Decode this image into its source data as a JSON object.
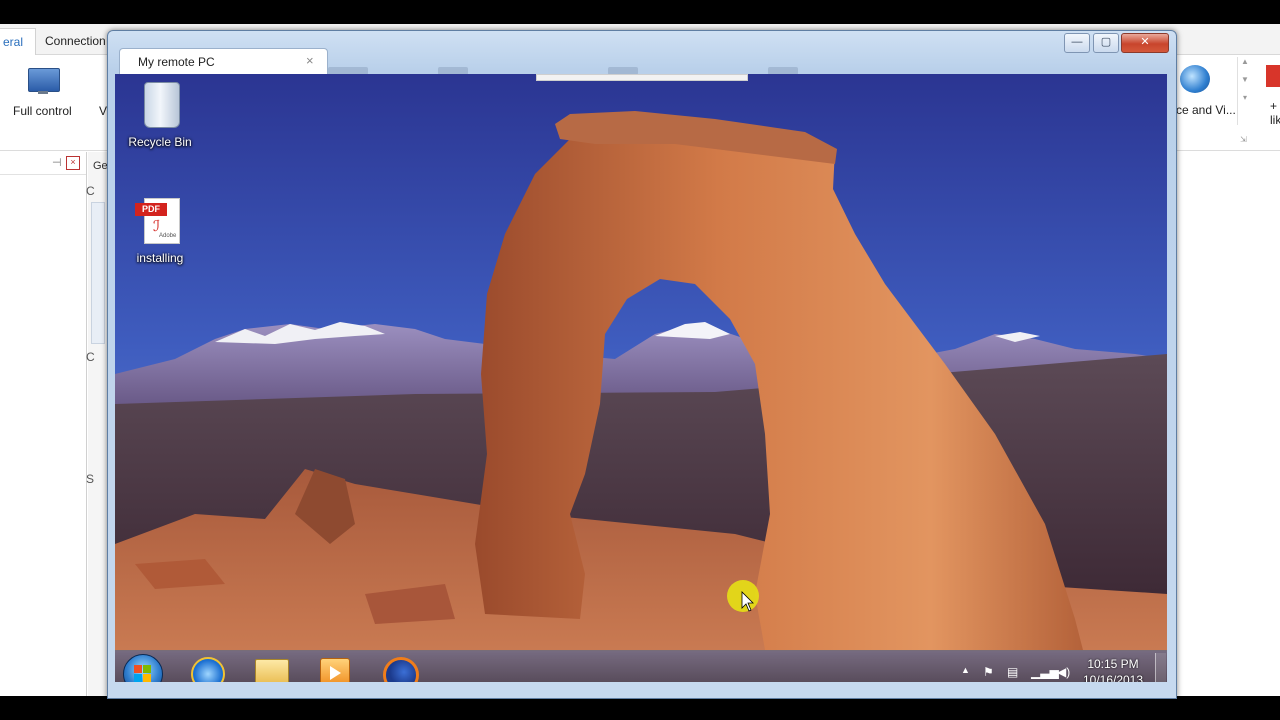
{
  "host_app": {
    "tabs": [
      {
        "label": "eral"
      },
      {
        "label": "Connection"
      }
    ],
    "ribbon": {
      "full_control_label": "Full control",
      "truncated_v_label": "V",
      "right_label": "ce and Vi...",
      "far_right_label": "+ lik"
    },
    "panel": {
      "truncated_ge": "Ge",
      "truncated_c1": "C",
      "truncated_c2": "C",
      "truncated_s": "S"
    }
  },
  "remote_window": {
    "tab_title": "My remote PC",
    "tab_close": "×",
    "controls": {
      "minimize": "—",
      "maximize": "▢",
      "close": "✕"
    }
  },
  "desktop": {
    "icons": [
      {
        "label": "Recycle Bin"
      },
      {
        "label": "installing"
      }
    ],
    "pdf_badge": "PDF",
    "pdf_brand": "Adobe",
    "taskbar": {
      "time": "10:15 PM",
      "date": "10/16/2013",
      "tray_arrow": "▲"
    }
  },
  "colors": {
    "host_accent": "#2a6fbd",
    "window_frame": "#b9d0ea",
    "close_button": "#c8452c",
    "sky_top": "#2f3f96",
    "arch_rock": "#c8683a"
  }
}
